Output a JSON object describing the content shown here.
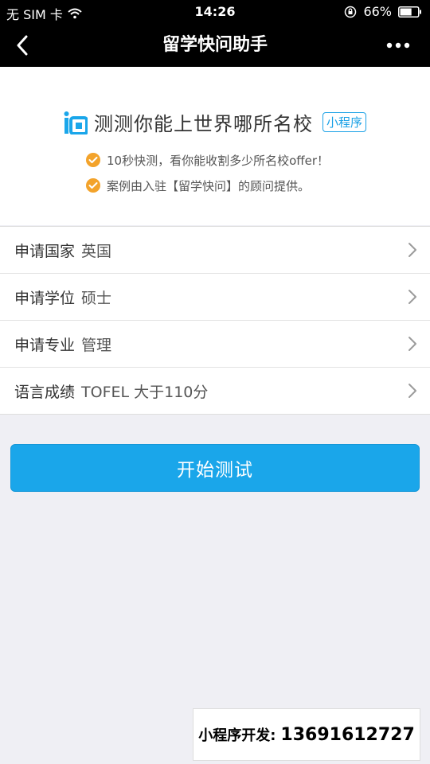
{
  "status_bar": {
    "carrier": "无 SIM 卡",
    "time": "14:26",
    "battery": "66%",
    "battery_level": 0.66
  },
  "nav": {
    "title": "留学快问助手"
  },
  "header": {
    "title": "测测你能上世界哪所名校",
    "badge": "小程序",
    "bullets": [
      "10秒快测，看你能收割多少所名校offer！",
      "案例由入驻【留学快问】的顾问提供。"
    ]
  },
  "rows": [
    {
      "label": "申请国家",
      "value": "英国"
    },
    {
      "label": "申请学位",
      "value": "硕士"
    },
    {
      "label": "申请专业",
      "value": "管理"
    },
    {
      "label": "语言成绩",
      "value": "TOFEL 大于110分"
    }
  ],
  "start_button": {
    "label": "开始测试"
  },
  "contact": {
    "label": "小程序开发:",
    "phone": "13691612727"
  },
  "colors": {
    "accent": "#1aa6ea",
    "check": "#f3a32b",
    "background": "#efeff4"
  }
}
